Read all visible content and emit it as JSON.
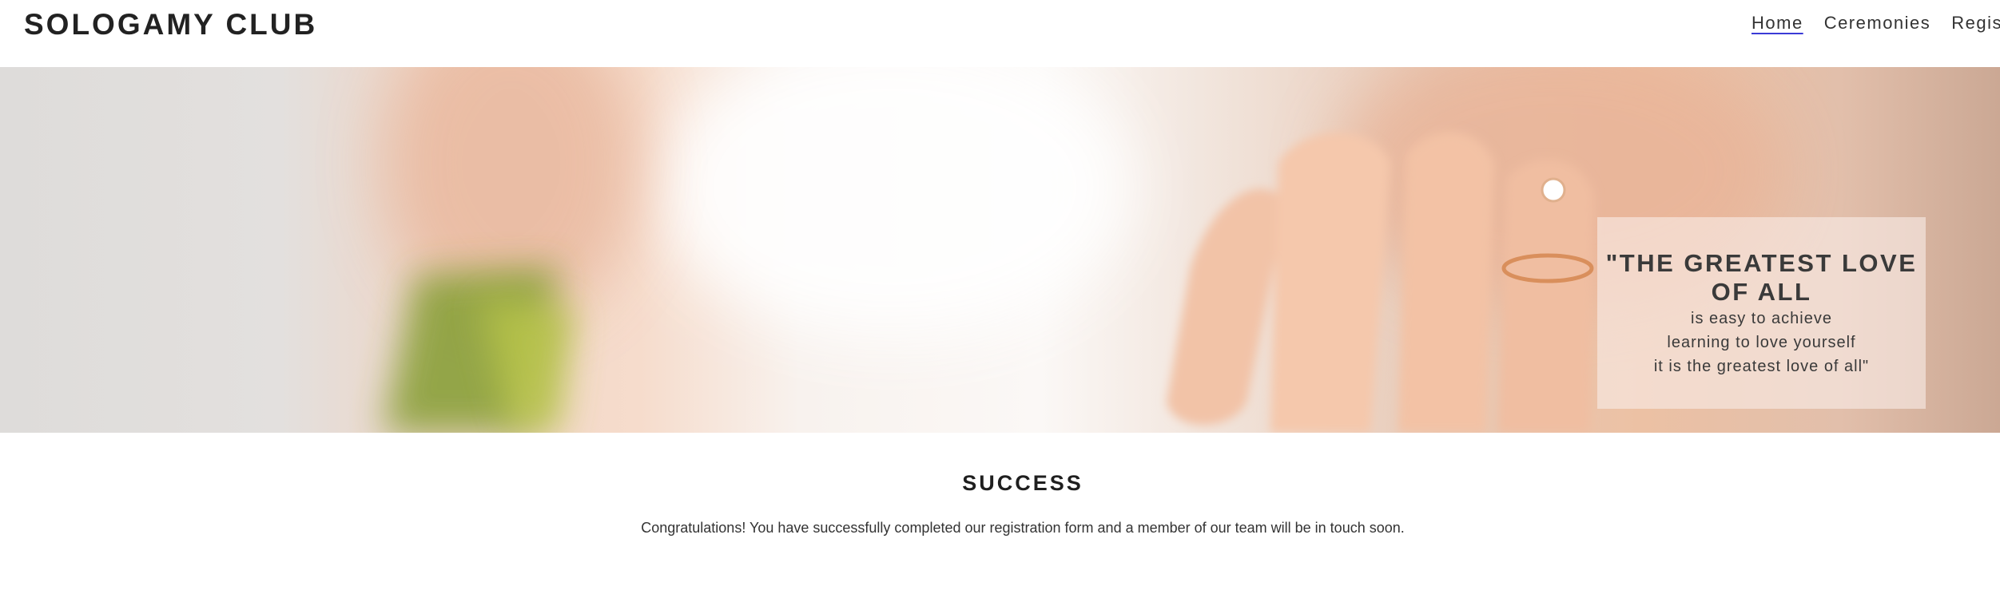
{
  "header": {
    "logo": "SOLOGAMY CLUB",
    "nav": [
      {
        "label": "Home",
        "active": true
      },
      {
        "label": "Ceremonies",
        "active": false
      },
      {
        "label": "Registration",
        "active": false
      }
    ]
  },
  "hero": {
    "quote_heading": "\"THE GREATEST LOVE OF ALL",
    "quote_lines": [
      "is easy to achieve",
      "learning to love yourself",
      "it is the greatest love of all\""
    ]
  },
  "content": {
    "title": "SUCCESS",
    "message": "Congratulations! You have successfully completed our registration form and a member of our team will be in touch soon."
  },
  "colors": {
    "nav_underline": "#3b3bd6",
    "text": "#2b2b2b"
  }
}
